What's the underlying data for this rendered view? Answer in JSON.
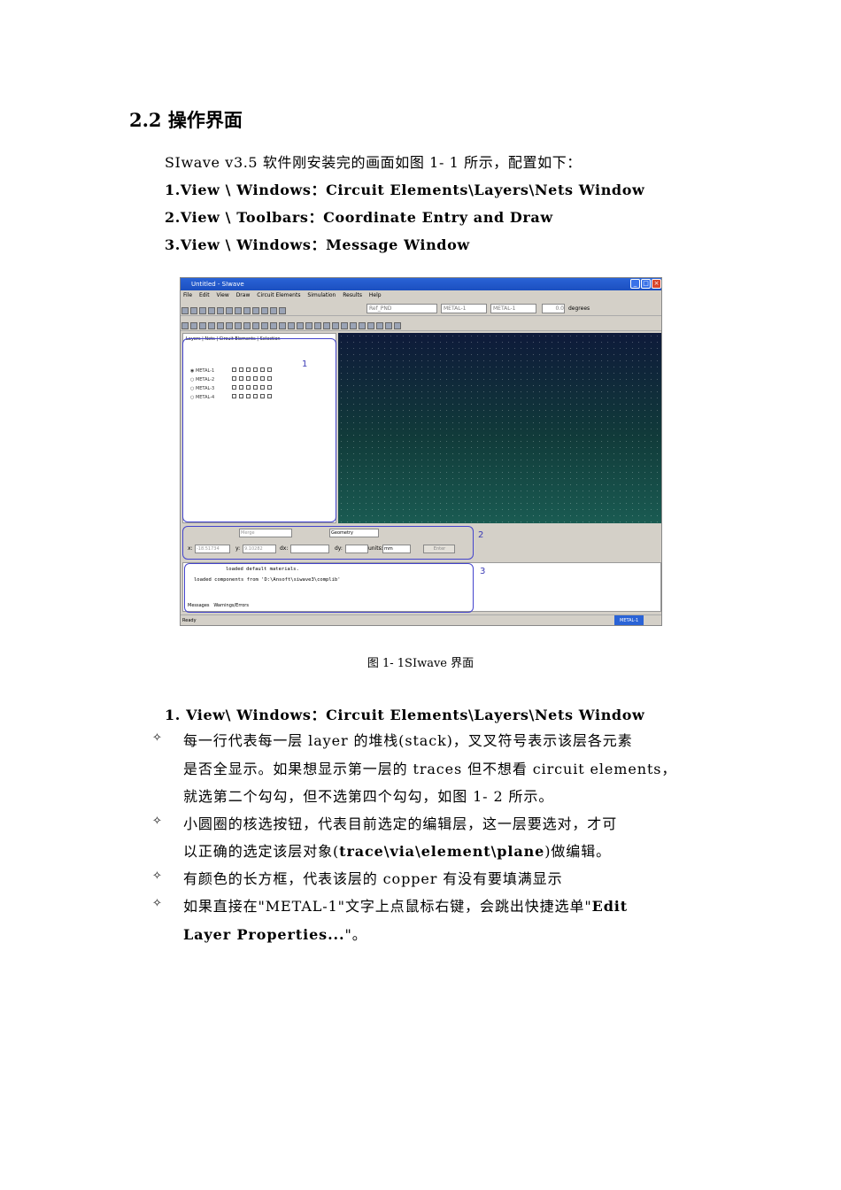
{
  "heading": "2.2 操作界面",
  "intro": "SIwave v3.5 软件刚安装完的画面如图 1- 1 所示，配置如下：",
  "config_items": [
    "1.View \\ Windows：Circuit Elements\\Layers\\Nets Window",
    "2.View \\ Toolbars：Coordinate Entry and Draw",
    "3.View \\ Windows：Message Window"
  ],
  "screenshot": {
    "title": "Untitled - SIwave",
    "menu": [
      "File",
      "Edit",
      "View",
      "Draw",
      "Circuit Elements",
      "Simulation",
      "Results",
      "Help"
    ],
    "combos": [
      "Ref_PND",
      "METAL-1",
      "METAL-1"
    ],
    "zoom_value": "0.0",
    "zoom_unit": "degrees",
    "panel_tabs": [
      "Layers",
      "Nets",
      "Circuit Elements",
      "Selection"
    ],
    "layers": [
      "METAL-1",
      "METAL-2",
      "METAL-3",
      "METAL-4"
    ],
    "coord_combo_1": "Merge",
    "coord_combo_2": "Geometry",
    "x_label": "x:",
    "x_value": "-18.51734",
    "y_label": "y:",
    "y_value": "9.10282",
    "dx_label": "dx:",
    "dy_label": "dy:",
    "units_label": "units:",
    "units_value": "mm",
    "enter_label": "Enter",
    "messages": [
      "loaded default materials.",
      "loaded components from 'D:\\Ansoft\\siwave3\\complib'"
    ],
    "msg_tabs": [
      "Messages",
      "Warnings/Errors"
    ],
    "status_left": "Ready",
    "status_right": "METAL-1",
    "labels": [
      "1",
      "2",
      "3"
    ]
  },
  "caption": "图 1- 1SIwave 界面",
  "section_title": "1. View\\ Windows：Circuit Elements\\Layers\\Nets Window",
  "bullet_glyph": "✧",
  "bullets": [
    {
      "lines": [
        "每一行代表每一层 layer 的堆栈(stack)，叉叉符号表示该层各元素",
        "是否全显示。如果想显示第一层的 traces 但不想看 circuit elements，",
        "就选第二个勾勾，但不选第四个勾勾，如图 1- 2 所示。"
      ]
    },
    {
      "lines_pre": "小圆圈的核选按钮，代表目前选定的编辑层，这一层要选对，才可",
      "line2_a": "以正确的选定该层对象(",
      "line2_b": "trace\\via\\element\\plane",
      "line2_c": ")做编辑。"
    },
    {
      "line": "有颜色的长方框，代表该层的 copper 有没有要填满显示"
    },
    {
      "line1_a": "如果直接在\"METAL-1\"文字上点鼠标右键，会跳出快捷选单\"",
      "line1_b": "Edit",
      "line2_a": "Layer Properties...",
      "line2_b": "\"。"
    }
  ]
}
